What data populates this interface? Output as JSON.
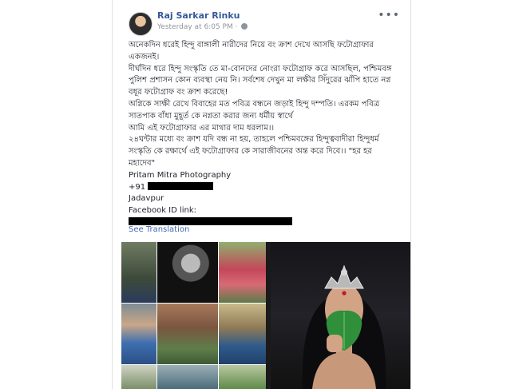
{
  "post": {
    "author": "Raj Sarkar Rinku",
    "timestamp": "Yesterday at 6:05 PM",
    "more_label": "•••",
    "body_lines": [
      "অনেকদিন ধরেই হিন্দু বাঙ্গালী নারীদের নিয়ে বং ক্রাশ দেখে আসছি ফটোগ্রাফার একজনই।",
      "দীর্ঘদিন ধরে হিন্দু সংস্কৃতি তে মা-বোনদের নোংরা ফটোগ্রাফ করে আসছিল, পশ্চিমবঙ্গ পুলিশ প্রশাসন কোন ব্যবস্থা নেয় নি। সর্বশেষ দেখুন মা লক্ষীর সিঁদুরের ঝাঁপি হাতে নগ্ন বধূর ফটোগ্রাফ বং ক্রাশ করেছে!",
      "অগ্নিকে সাক্ষী রেখে বিবাহের মত পবিত্র বন্ধনে জড়াই হিন্দু দম্পতি। এরকম পবিত্র সাতপাক বাঁধা মুহূর্ত কে নগ্নতা করার জন্য ধর্মীয় স্বার্থে",
      "আমি এই ফটোগ্রাফার এর মাথার দাম ধরলাম।।",
      "২৪ঘন্টার মধ্যে বং ক্রাশ যদি বন্ধ না হয়, তাহলে পশ্চিমবঙ্গের হিন্দুত্ববাদীরা হিন্দুধর্ম সংস্কৃতি কে রক্ষার্থে এই ফটোগ্রাফার কে সারাজীবনের অন্ত করে দিবে।। \"হর হর মহাদেব\"",
      "Pritam Mitra Photography"
    ],
    "phone_prefix": "+91",
    "location": "Jadavpur",
    "fb_id_label": "Facebook ID link:",
    "see_translation": "See Translation"
  },
  "gallery": {
    "thumbnail_count": 12,
    "featured_image": "woman-crown-green-leaf-photo"
  },
  "colors": {
    "author_link": "#365899",
    "meta_text": "#90949c",
    "link_blue": "#4267b2",
    "body_text": "#1d2129",
    "redaction": "#000000"
  }
}
